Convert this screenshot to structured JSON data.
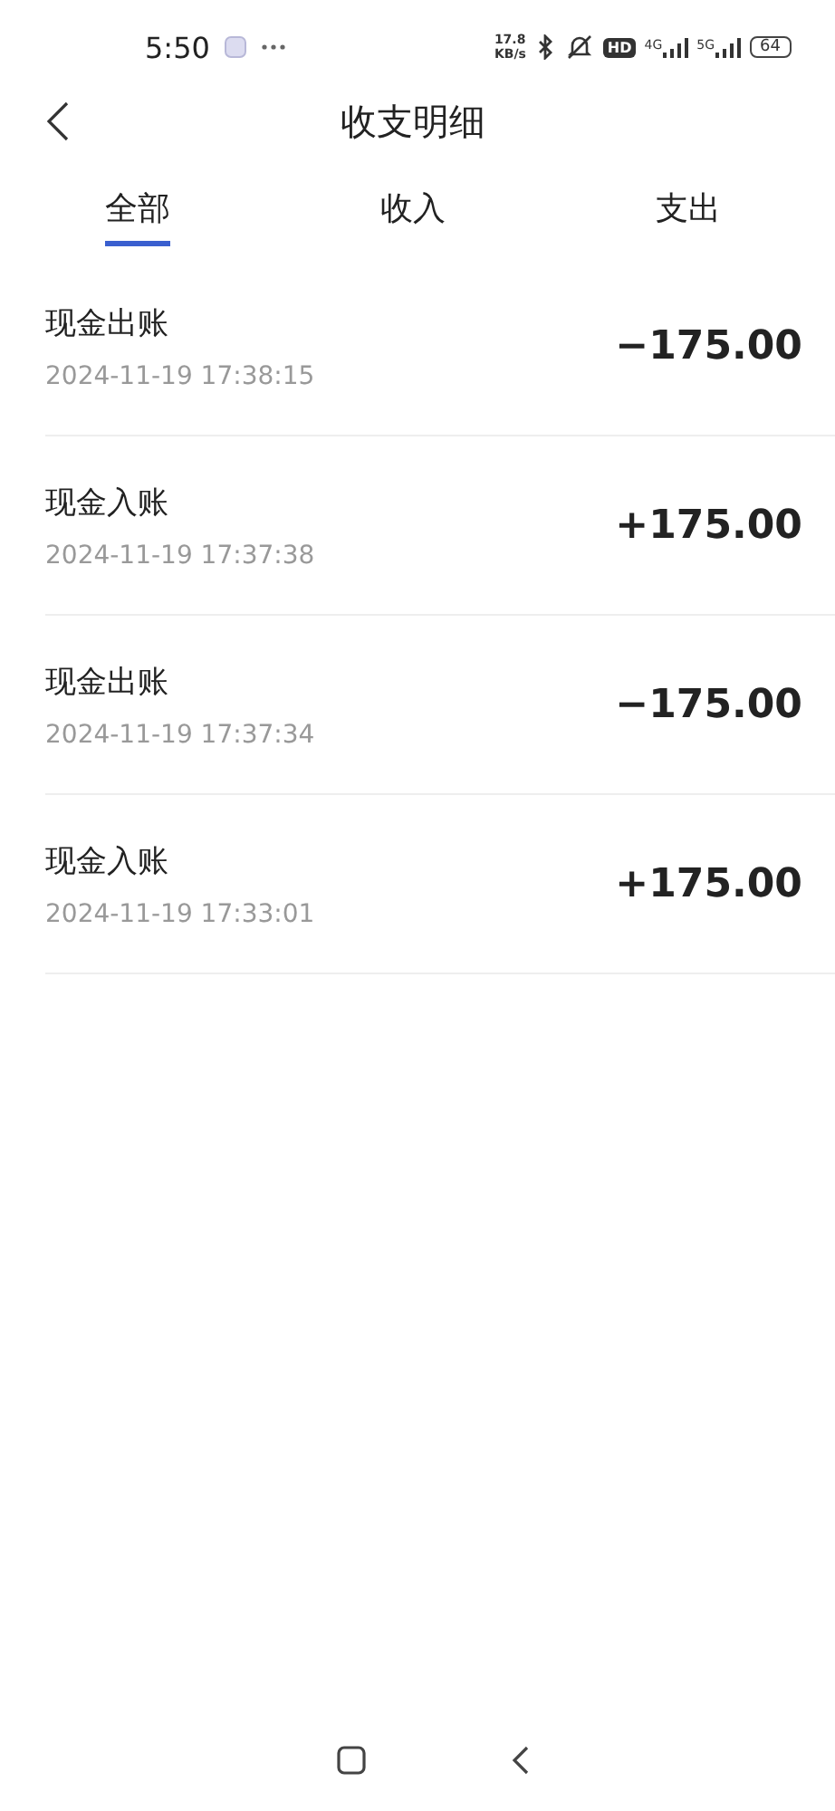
{
  "status_bar": {
    "time": "5:50",
    "net_speed": "17.8",
    "net_unit": "KB/s",
    "hd": "HD",
    "sim1": "4G",
    "sim2": "5G",
    "battery": "64"
  },
  "header": {
    "title": "收支明细"
  },
  "tabs": [
    {
      "label": "全部",
      "selected": true
    },
    {
      "label": "收入",
      "selected": false
    },
    {
      "label": "支出",
      "selected": false
    }
  ],
  "records": [
    {
      "title": "现金出账",
      "time": "2024-11-19 17:38:15",
      "amount": "−175.00"
    },
    {
      "title": "现金入账",
      "time": "2024-11-19 17:37:38",
      "amount": "+175.00"
    },
    {
      "title": "现金出账",
      "time": "2024-11-19 17:37:34",
      "amount": "−175.00"
    },
    {
      "title": "现金入账",
      "time": "2024-11-19 17:33:01",
      "amount": "+175.00"
    }
  ]
}
